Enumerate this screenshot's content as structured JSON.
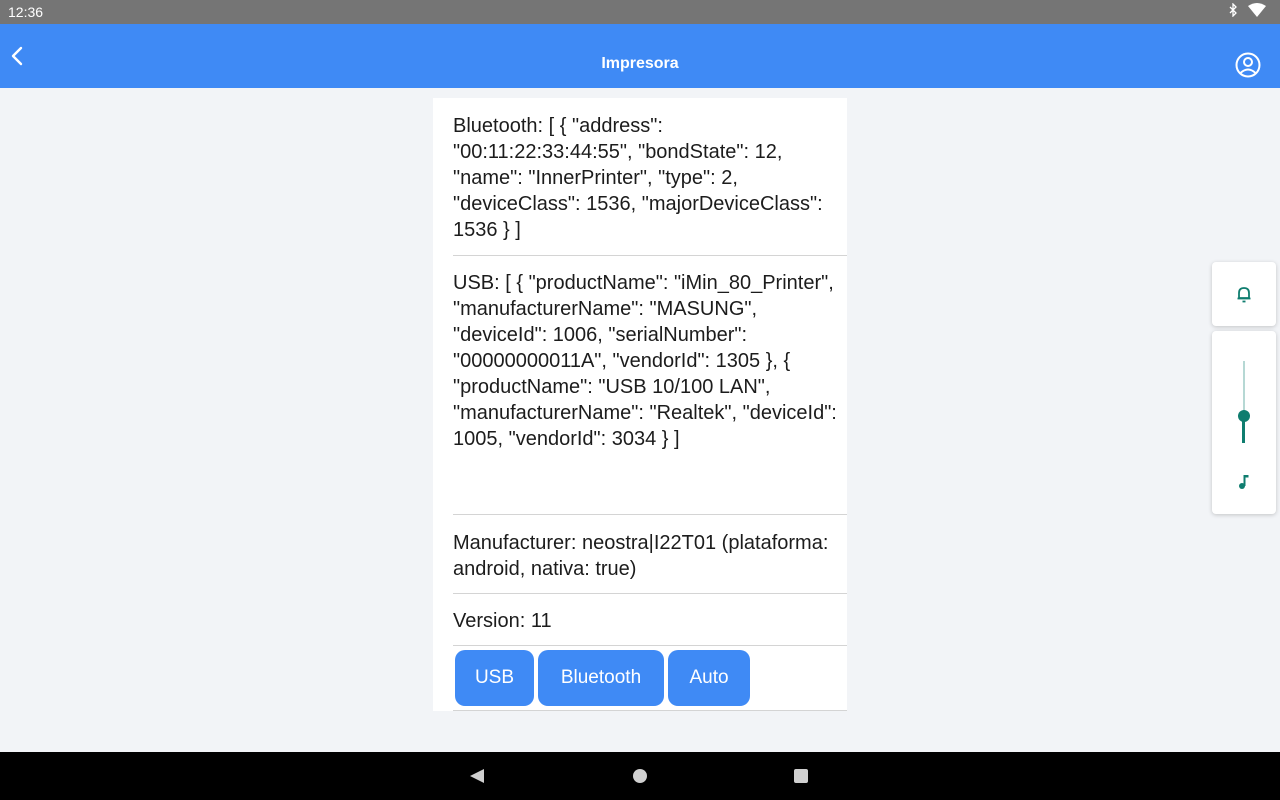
{
  "status_bar": {
    "time": "12:36",
    "icons": [
      "bluetooth-icon",
      "wifi-icon"
    ]
  },
  "app_bar": {
    "title": "Impresora",
    "back_icon": "chevron-left-icon",
    "profile_icon": "account-circle-icon"
  },
  "info": {
    "bluetooth": "Bluetooth: [ { \"address\": \"00:11:22:33:44:55\", \"bondState\": 12, \"name\": \"InnerPrinter\", \"type\": 2, \"deviceClass\": 1536, \"majorDeviceClass\": 1536 } ]",
    "usb": "USB: [ { \"productName\": \"iMin_80_Printer\", \"manufacturerName\": \"MASUNG\", \"deviceId\": 1006, \"serialNumber\": \"00000000011A\", \"vendorId\": 1305 }, { \"productName\": \"USB 10/100 LAN\", \"manufacturerName\": \"Realtek\", \"deviceId\": 1005, \"vendorId\": 3034 } ]",
    "manufacturer": "Manufacturer: neostra|I22T01 (plataforma: android, nativa: true)",
    "version": "Version: 11"
  },
  "buttons": {
    "usb": "USB",
    "bluetooth": "Bluetooth",
    "auto": "Auto"
  },
  "volume_panel": {
    "ringer_icon": "bell-icon",
    "media_icon": "music-note-icon",
    "media_volume_level": 0.33
  },
  "nav_bar": {
    "back": "nav-back-icon",
    "home": "nav-home-icon",
    "recents": "nav-recents-icon"
  },
  "colors": {
    "accent": "#3f8af5",
    "volume_accent": "#0f7d6f"
  }
}
